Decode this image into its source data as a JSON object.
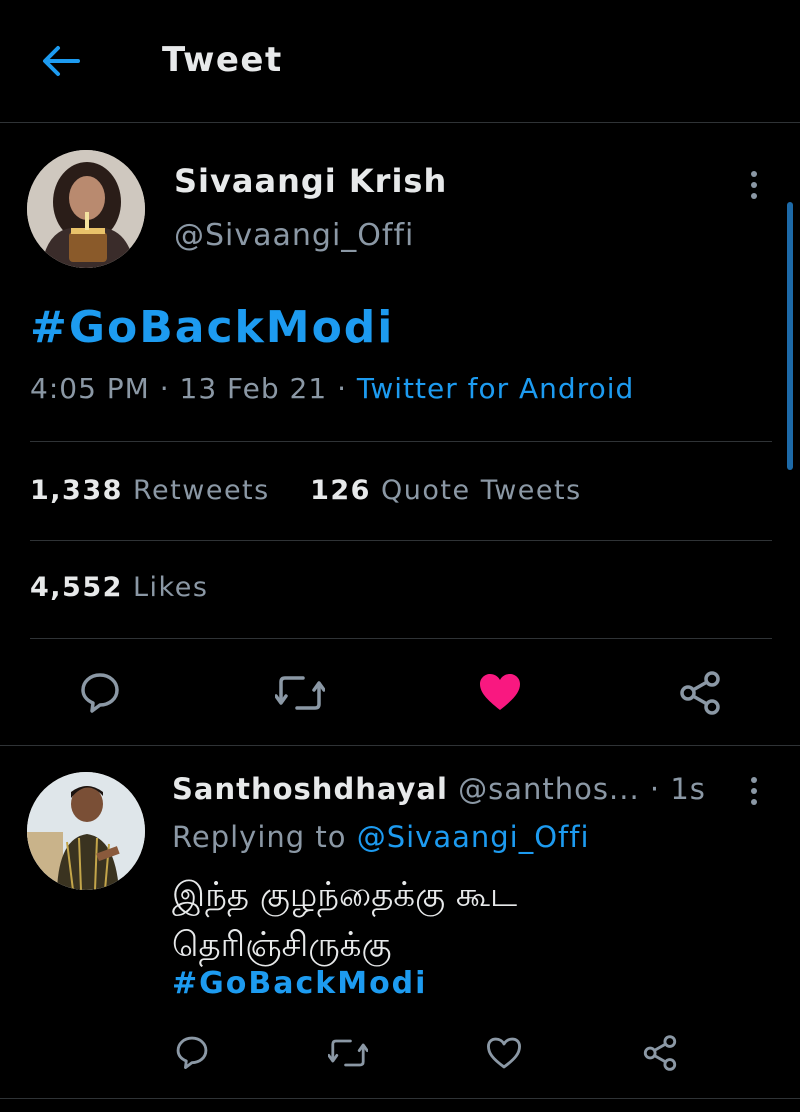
{
  "header": {
    "title": "Tweet"
  },
  "tweet": {
    "name": "Sivaangi Krish",
    "handle": "@Sivaangi_Offi",
    "text": "#GoBackModi",
    "time": "4:05 PM",
    "separator": " · ",
    "date": "13 Feb 21",
    "source": "Twitter for Android",
    "retweets_count": "1,338",
    "retweets_label": "Retweets",
    "quote_count": "126",
    "quote_label": "Quote Tweets",
    "likes_count": "4,552",
    "likes_label": "Likes",
    "liked": true
  },
  "reply": {
    "name": "Santhoshdhayal",
    "handle": "@santhos...",
    "time": "1s",
    "replying_prefix": "Replying to",
    "replying_to": "@Sivaangi_Offi",
    "text_line1": "இந்த குழந்தைக்கு கூட",
    "text_line2": "தெரிஞ்சிருக்கு",
    "hashtag": "#GoBackModi"
  },
  "colors": {
    "accent": "#1d9bf0",
    "like": "#f91880",
    "background": "#000000",
    "secondary_text": "#8b98a5"
  },
  "icons": {
    "back": "arrow-left-icon",
    "more": "more-vertical-icon",
    "reply": "comment-icon",
    "retweet": "retweet-icon",
    "like": "heart-icon",
    "share": "share-icon"
  }
}
